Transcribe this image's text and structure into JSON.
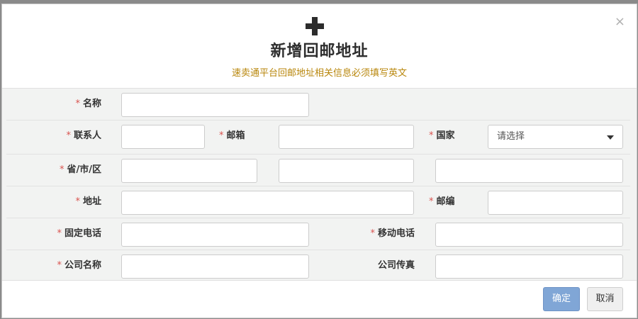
{
  "dialog": {
    "icon": "plus-icon",
    "title": "新增回邮地址",
    "subtitle": "速卖通平台回邮地址相关信息必须填写英文",
    "close_label": "×"
  },
  "form": {
    "required_mark": "*",
    "name_label": "名称",
    "contact_label": "联系人",
    "email_label": "邮箱",
    "country_label": "国家",
    "country_selected": "请选择",
    "province_label": "省/市/区",
    "address_label": "地址",
    "postcode_label": "邮编",
    "phone_label": "固定电话",
    "mobile_label": "移动电话",
    "company_label": "公司名称",
    "company_fax_label": "公司传真"
  },
  "footer": {
    "ok_label": "确定",
    "cancel_label": "取消"
  },
  "colors": {
    "subtitle": "#b8860b",
    "required": "#d9534f",
    "primary_button": "#80a6d6"
  }
}
